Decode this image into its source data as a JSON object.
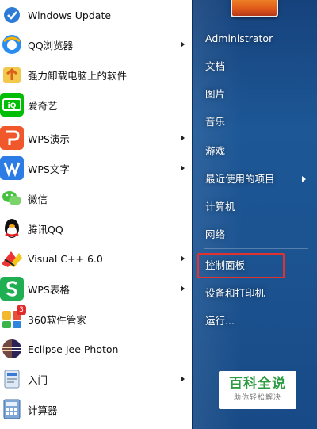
{
  "programs": [
    {
      "label": "Windows Update",
      "icon": "windows-update-icon",
      "submenu": false
    },
    {
      "label": "QQ浏览器",
      "icon": "qq-browser-icon",
      "submenu": true
    },
    {
      "label": "强力卸载电脑上的软件",
      "icon": "uninstall-box-icon",
      "submenu": false
    },
    {
      "label": "爱奇艺",
      "icon": "iqiyi-icon",
      "submenu": false
    },
    {
      "label": "WPS演示",
      "icon": "wps-presentation-icon",
      "submenu": true
    },
    {
      "label": "WPS文字",
      "icon": "wps-writer-icon",
      "submenu": true
    },
    {
      "label": "微信",
      "icon": "wechat-icon",
      "submenu": false
    },
    {
      "label": "腾讯QQ",
      "icon": "qq-penguin-icon",
      "submenu": false
    },
    {
      "label": "Visual C++ 6.0",
      "icon": "visual-cpp-icon",
      "submenu": true
    },
    {
      "label": "WPS表格",
      "icon": "wps-spreadsheet-icon",
      "submenu": true
    },
    {
      "label": "360软件管家",
      "icon": "360-software-manager-icon",
      "submenu": false,
      "badge": "3"
    },
    {
      "label": "Eclipse Jee Photon",
      "icon": "eclipse-icon",
      "submenu": false
    },
    {
      "label": "入门",
      "icon": "getting-started-icon",
      "submenu": true
    },
    {
      "label": "计算器",
      "icon": "calculator-icon",
      "submenu": false
    }
  ],
  "right_menu": {
    "user": "Administrator",
    "items": [
      {
        "label": "文档",
        "submenu": false
      },
      {
        "label": "图片",
        "submenu": false
      },
      {
        "label": "音乐",
        "submenu": false
      },
      {
        "label": "游戏",
        "submenu": false
      },
      {
        "label": "最近使用的项目",
        "submenu": true
      },
      {
        "label": "计算机",
        "submenu": false
      },
      {
        "label": "网络",
        "submenu": false
      },
      {
        "label": "控制面板",
        "submenu": false
      },
      {
        "label": "设备和打印机",
        "submenu": false
      },
      {
        "label": "运行...",
        "submenu": false
      }
    ]
  },
  "watermark": {
    "title": "百科全说",
    "subtitle": "助你轻松解决"
  },
  "colors": {
    "right_pane": "#1d5796",
    "highlight": "#e0322e",
    "watermark_green": "#2e9b45"
  }
}
